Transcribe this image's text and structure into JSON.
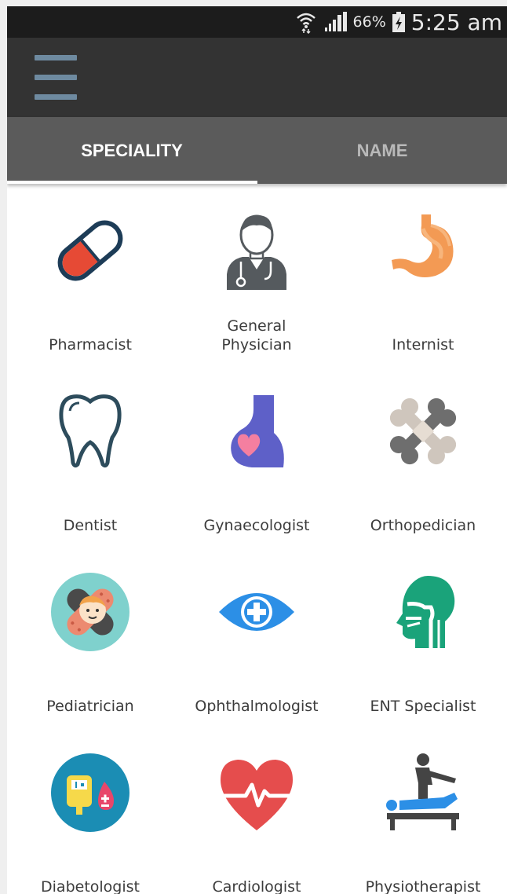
{
  "status_bar": {
    "battery_percent": "66%",
    "time": "5:25 am",
    "icons": [
      "wifi-icon",
      "signal-icon",
      "battery-charging-icon"
    ]
  },
  "app_bar": {
    "menu_icon": "hamburger-menu-icon"
  },
  "tabs": [
    {
      "label": "SPECIALITY",
      "selected": true
    },
    {
      "label": "NAME",
      "selected": false
    }
  ],
  "specialities": [
    {
      "label": "Pharmacist",
      "icon": "capsule-icon"
    },
    {
      "label": "General\nPhysician",
      "icon": "doctor-icon"
    },
    {
      "label": "Internist",
      "icon": "stomach-icon"
    },
    {
      "label": "Dentist",
      "icon": "tooth-icon"
    },
    {
      "label": "Gynaecologist",
      "icon": "pregnancy-icon"
    },
    {
      "label": "Orthopedician",
      "icon": "bone-icon"
    },
    {
      "label": "Pediatrician",
      "icon": "baby-bandage-icon"
    },
    {
      "label": "Ophthalmologist",
      "icon": "eye-icon"
    },
    {
      "label": "ENT Specialist",
      "icon": "ent-head-icon"
    },
    {
      "label": "Diabetologist",
      "icon": "glucose-icon"
    },
    {
      "label": "Cardiologist",
      "icon": "heart-pulse-icon"
    },
    {
      "label": "Physiotherapist",
      "icon": "physiotherapy-icon"
    }
  ],
  "colors": {
    "status_bar": "#1c1c1c",
    "app_bar": "#333333",
    "tab_bar": "#5b5b5b",
    "tab_selected_text": "#ffffff",
    "tab_unselected_text": "#b9b9b9",
    "menu_icon": "#6e8aa0"
  }
}
